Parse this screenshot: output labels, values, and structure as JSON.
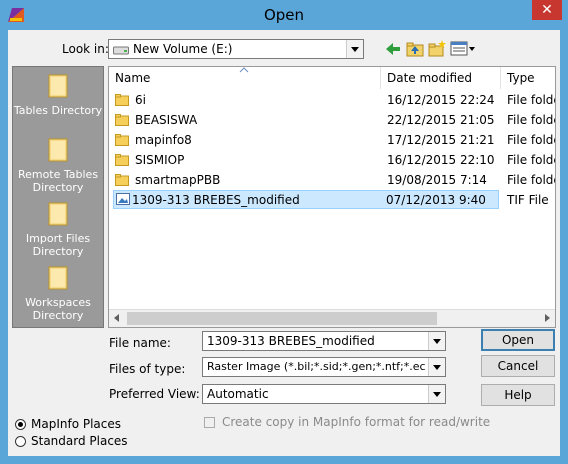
{
  "window": {
    "title": "Open",
    "close_label": "✕"
  },
  "look_in": {
    "label": "Look in:",
    "value": "New Volume (E:)"
  },
  "toolbar": {
    "back_icon": "back-arrow-icon",
    "up_icon": "up-folder-icon",
    "new_folder_icon": "new-folder-icon",
    "view_icon": "view-menu-icon"
  },
  "sidebar": {
    "items": [
      {
        "label": "Tables Directory"
      },
      {
        "label": "Remote Tables Directory"
      },
      {
        "label": "Import Files Directory"
      },
      {
        "label": "Workspaces Directory"
      }
    ]
  },
  "file_list": {
    "columns": {
      "name": "Name",
      "date": "Date modified",
      "type": "Type"
    },
    "rows": [
      {
        "name": "6i",
        "date": "16/12/2015 22:24",
        "type": "File folder",
        "kind": "folder"
      },
      {
        "name": "BEASISWA",
        "date": "22/12/2015 21:05",
        "type": "File folder",
        "kind": "folder"
      },
      {
        "name": "mapinfo8",
        "date": "17/12/2015 21:21",
        "type": "File folder",
        "kind": "folder"
      },
      {
        "name": "SISMIOP",
        "date": "16/12/2015 22:10",
        "type": "File folder",
        "kind": "folder"
      },
      {
        "name": "smartmapPBB",
        "date": "19/08/2015 7:14",
        "type": "File folder",
        "kind": "folder"
      },
      {
        "name": "1309-313 BREBES_modified",
        "date": "07/12/2013 9:40",
        "type": "TIF File",
        "kind": "image"
      }
    ]
  },
  "form": {
    "file_name_label": "File name:",
    "file_name_value": "1309-313 BREBES_modified",
    "files_of_type_label": "Files of type:",
    "files_of_type_value": "Raster Image (*.bil;*.sid;*.gen;*.ntf;*.ecw;*.url;*.t",
    "preferred_view_label": "Preferred View:",
    "preferred_view_value": "Automatic",
    "copy_checkbox_label": "Create copy in MapInfo format for read/write"
  },
  "buttons": {
    "open": "Open",
    "cancel": "Cancel",
    "help": "Help"
  },
  "places": {
    "mapinfo": "MapInfo Places",
    "standard": "Standard Places",
    "selected": "mapinfo"
  },
  "colors": {
    "titlebar": "#5ba6d9",
    "close": "#c7372f",
    "selection": "#cce8ff",
    "sidebar": "#9a9a9a"
  }
}
